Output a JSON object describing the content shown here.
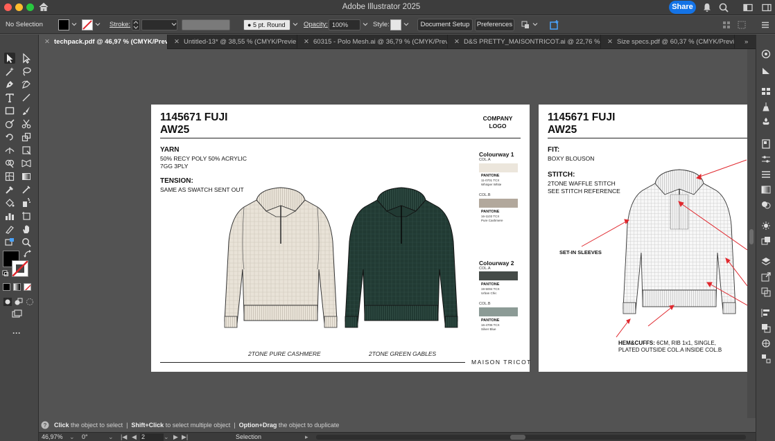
{
  "window": {
    "title": "Adobe Illustrator 2025",
    "share_label": "Share"
  },
  "control_bar": {
    "selection_status": "No Selection",
    "stroke_label": "Stroke:",
    "brush_value": "5 pt. Round",
    "opacity_label": "Opacity:",
    "opacity_value": "100%",
    "style_label": "Style:",
    "document_setup_label": "Document Setup",
    "preferences_label": "Preferences"
  },
  "tabs": [
    {
      "label": "techpack.pdf @ 46,97 % (CMYK/Preview)",
      "active": true
    },
    {
      "label": "Untitled-13* @ 38,55 % (CMYK/Previe...",
      "active": false
    },
    {
      "label": "60315 - Polo Mesh.ai @ 36,79 % (CMYK/Previe...",
      "active": false
    },
    {
      "label": "D&S PRETTY_MAISONTRICOT.ai @ 22,76 % (CM...",
      "active": false
    },
    {
      "label": "Size specs.pdf @ 60,37 % (CMYK/Previe...",
      "active": false
    }
  ],
  "artboard1": {
    "title_line1": "1145671 FUJI",
    "title_line2": "AW25",
    "company_logo_line1": "COMPANY",
    "company_logo_line2": "LOGO",
    "yarn_heading": "YARN",
    "yarn_line1": "50% RECY POLY 50% ACRYLIC",
    "yarn_line2": "7GG 3PLY",
    "tension_heading": "TENSION:",
    "tension_text": "SAME AS SWATCH SENT OUT",
    "colourway1": {
      "title": "Colourway 1",
      "col_a_label": "COL.A",
      "col_a_color": "#ece6dc",
      "col_a_brand": "PANTONE",
      "col_a_code": "11-0701 TCX",
      "col_a_name": "Whisper White",
      "col_b_label": "COL.B",
      "col_b_color": "#b2a89c",
      "col_b_brand": "PANTONE",
      "col_b_code": "16-1103 TCX",
      "col_b_name": "Pure Cashmere"
    },
    "colourway2": {
      "title": "Colourway 2",
      "col_a_label": "COL.A",
      "col_a_color": "#454b48",
      "col_a_brand": "PANTONE",
      "col_a_code": "19-5004 TCX",
      "col_a_name": "Urban Chic",
      "col_b_label": "COL.B",
      "col_b_color": "#8c9b96",
      "col_b_brand": "PANTONE",
      "col_b_code": "16-4706 TCX",
      "col_b_name": "Silver Blue"
    },
    "caption_left": "2TONE PURE CASHMERE",
    "caption_right": "2TONE GREEN GABLES",
    "brand": "MAISON TRICOT",
    "sweater_light_color": "#e9e3d8",
    "sweater_dark_color": "#213a33"
  },
  "artboard2": {
    "title_line1": "1145671 FUJI",
    "title_line2": "AW25",
    "fit_heading": "FIT:",
    "fit_text": "BOXY BLOUSON",
    "stitch_heading": "STITCH:",
    "stitch_line1": "2TONE WAFFLE STITCH",
    "stitch_line2": "SEE STITCH REFERENCE",
    "sleeve_note": "SET-IN SLEEVES",
    "hem_heading": "HEM&CUFFS:",
    "hem_text": "6CM, RIB 1x1, SINGLE,",
    "hem_line2": "PLATED OUTSIDE COL.A INSIDE COL.B",
    "annotation_color": "#e0282e"
  },
  "status": {
    "hint_click": "Click",
    "hint_click_rest": "the object to select",
    "hint_shift": "Shift+Click",
    "hint_shift_rest": "to select multiple object",
    "hint_option": "Option+Drag",
    "hint_option_rest": "the object to duplicate",
    "zoom": "46,97%",
    "rotation": "0°",
    "artboard_number": "2",
    "current_tool": "Selection"
  }
}
